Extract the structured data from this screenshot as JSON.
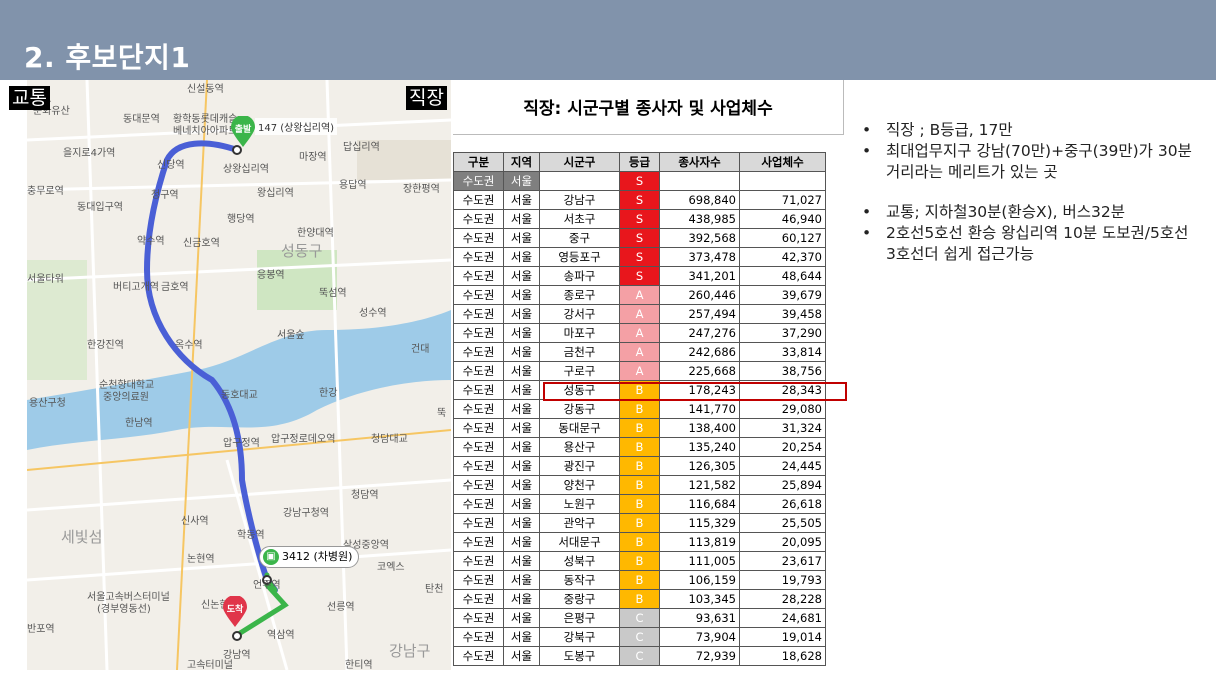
{
  "header": {
    "title": "2. 후보단지1"
  },
  "badges": {
    "transport": "교통",
    "work": "직장"
  },
  "map": {
    "start_pin": "출발",
    "end_pin": "도착",
    "start_route_label": "147 (상왕십리역)",
    "bus_chip": "3412 (차병원)",
    "labels": {
      "l1": "신설동역",
      "l2": "종묘",
      "l3": "문화유산",
      "l4": "동대문역",
      "l5": "황학동롯데캐슬",
      "l6": "베네치아아파트",
      "l7": "을지로4가역",
      "l8": "신당역",
      "l9": "상왕십리역",
      "l10": "마장역",
      "l11": "답십리역",
      "l12": "충무로역",
      "l13": "청구역",
      "l14": "왕십리역",
      "l15": "용답역",
      "l16": "장한평역",
      "l17": "동대입구역",
      "l18": "행당역",
      "l19": "약수역",
      "l20": "신금호역",
      "l21": "한양대역",
      "l22": "성동구",
      "l23": "서울타워",
      "l24": "버티고개역",
      "l25": "금호역",
      "l26": "응봉역",
      "l27": "뚝섬역",
      "l28": "서울숲",
      "l29": "성수역",
      "l30": "한강진역",
      "l31": "옥수역",
      "l32": "순천향대학교",
      "l33": "중앙의료원",
      "l34": "용산구청",
      "l35": "동호대교",
      "l36": "한강",
      "l37": "한남역",
      "l38": "압구정역",
      "l39": "압구정로데오역",
      "l40": "청담대교",
      "l41": "신사역",
      "l42": "강남구청역",
      "l43": "학동역",
      "l44": "청담역",
      "l45": "세빛섬",
      "l46": "논현역",
      "l47": "삼성중앙역",
      "l48": "코엑스",
      "l49": "서울고속버스터미널",
      "l50": "(경부영동선)",
      "l51": "반포역",
      "l52": "신논현역",
      "l53": "선릉역",
      "l54": "언주역",
      "l55": "역삼역",
      "l56": "강남역",
      "l57": "강남구",
      "l58": "한티역",
      "l59": "건대",
      "l60": "탄천",
      "l61": "고속터미널",
      "l62": "뚝"
    },
    "colors": {
      "subway_route": "#4a5fd6",
      "walk_route": "#3bb54a",
      "river": "#9ecbe8",
      "park": "#cfe6c2"
    }
  },
  "table": {
    "title": "직장: 시군구별 종사자 및 사업체수",
    "headers": [
      "구분",
      "지역",
      "시군구",
      "등급",
      "종사자수",
      "사업체수"
    ],
    "summary_row": {
      "region": "수도권",
      "area": "서울",
      "grade": "S"
    },
    "rows": [
      {
        "region": "수도권",
        "area": "서울",
        "district": "강남구",
        "grade": "S",
        "workers": "698,840",
        "businesses": "71,027"
      },
      {
        "region": "수도권",
        "area": "서울",
        "district": "서초구",
        "grade": "S",
        "workers": "438,985",
        "businesses": "46,940"
      },
      {
        "region": "수도권",
        "area": "서울",
        "district": "중구",
        "grade": "S",
        "workers": "392,568",
        "businesses": "60,127"
      },
      {
        "region": "수도권",
        "area": "서울",
        "district": "영등포구",
        "grade": "S",
        "workers": "373,478",
        "businesses": "42,370"
      },
      {
        "region": "수도권",
        "area": "서울",
        "district": "송파구",
        "grade": "S",
        "workers": "341,201",
        "businesses": "48,644"
      },
      {
        "region": "수도권",
        "area": "서울",
        "district": "종로구",
        "grade": "A",
        "workers": "260,446",
        "businesses": "39,679"
      },
      {
        "region": "수도권",
        "area": "서울",
        "district": "강서구",
        "grade": "A",
        "workers": "257,494",
        "businesses": "39,458"
      },
      {
        "region": "수도권",
        "area": "서울",
        "district": "마포구",
        "grade": "A",
        "workers": "247,276",
        "businesses": "37,290"
      },
      {
        "region": "수도권",
        "area": "서울",
        "district": "금천구",
        "grade": "A",
        "workers": "242,686",
        "businesses": "33,814"
      },
      {
        "region": "수도권",
        "area": "서울",
        "district": "구로구",
        "grade": "A",
        "workers": "225,668",
        "businesses": "38,756"
      },
      {
        "region": "수도권",
        "area": "서울",
        "district": "성동구",
        "grade": "B",
        "workers": "178,243",
        "businesses": "28,343"
      },
      {
        "region": "수도권",
        "area": "서울",
        "district": "강동구",
        "grade": "B",
        "workers": "141,770",
        "businesses": "29,080"
      },
      {
        "region": "수도권",
        "area": "서울",
        "district": "동대문구",
        "grade": "B",
        "workers": "138,400",
        "businesses": "31,324"
      },
      {
        "region": "수도권",
        "area": "서울",
        "district": "용산구",
        "grade": "B",
        "workers": "135,240",
        "businesses": "20,254"
      },
      {
        "region": "수도권",
        "area": "서울",
        "district": "광진구",
        "grade": "B",
        "workers": "126,305",
        "businesses": "24,445"
      },
      {
        "region": "수도권",
        "area": "서울",
        "district": "양천구",
        "grade": "B",
        "workers": "121,582",
        "businesses": "25,894"
      },
      {
        "region": "수도권",
        "area": "서울",
        "district": "노원구",
        "grade": "B",
        "workers": "116,684",
        "businesses": "26,618"
      },
      {
        "region": "수도권",
        "area": "서울",
        "district": "관악구",
        "grade": "B",
        "workers": "115,329",
        "businesses": "25,505"
      },
      {
        "region": "수도권",
        "area": "서울",
        "district": "서대문구",
        "grade": "B",
        "workers": "113,819",
        "businesses": "20,095"
      },
      {
        "region": "수도권",
        "area": "서울",
        "district": "성북구",
        "grade": "B",
        "workers": "111,005",
        "businesses": "23,617"
      },
      {
        "region": "수도권",
        "area": "서울",
        "district": "동작구",
        "grade": "B",
        "workers": "106,159",
        "businesses": "19,793"
      },
      {
        "region": "수도권",
        "area": "서울",
        "district": "중랑구",
        "grade": "B",
        "workers": "103,345",
        "businesses": "28,228"
      },
      {
        "region": "수도권",
        "area": "서울",
        "district": "은평구",
        "grade": "C",
        "workers": "93,631",
        "businesses": "24,681"
      },
      {
        "region": "수도권",
        "area": "서울",
        "district": "강북구",
        "grade": "C",
        "workers": "73,904",
        "businesses": "19,014"
      },
      {
        "region": "수도권",
        "area": "서울",
        "district": "도봉구",
        "grade": "C",
        "workers": "72,939",
        "businesses": "18,628"
      }
    ],
    "highlighted_district": "성동구",
    "grade_colors": {
      "S": "#e8161c",
      "A": "#f4a0a5",
      "B": "#ffb800",
      "C": "#c9c9c9"
    }
  },
  "notes": {
    "bullet": "•",
    "n1": "직장 ;  B등급, 17만",
    "n2": "최대업무지구 강남(70만)+중구(39만)가 30분 거리라는 메리트가 있는 곳",
    "n3": "교통; 지하철30분(환승X), 버스32분",
    "n4": "2호선5호선 환승 왕십리역 10분 도보권/5호선 3호선더 쉽게 접근가능"
  }
}
